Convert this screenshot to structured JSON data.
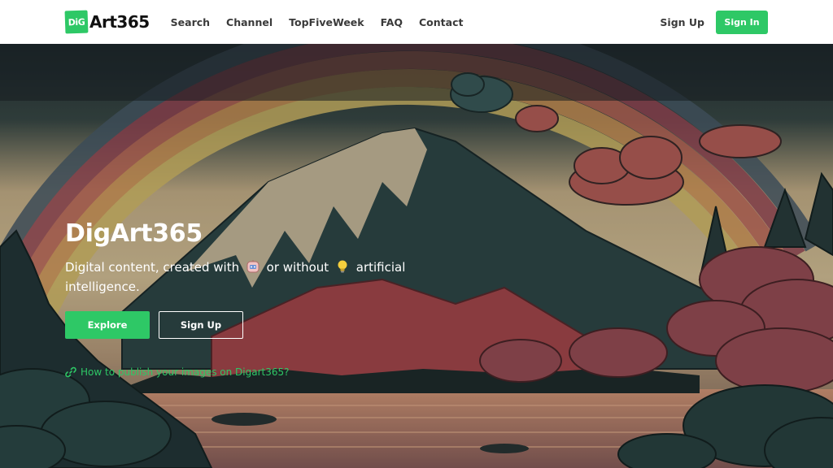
{
  "header": {
    "logo_badge": "DiG",
    "logo_text": "Art365",
    "nav": [
      {
        "label": "Search"
      },
      {
        "label": "Channel"
      },
      {
        "label": "TopFiveWeek"
      },
      {
        "label": "FAQ"
      },
      {
        "label": "Contact"
      }
    ],
    "signup_label": "Sign Up",
    "signin_label": "Sign In"
  },
  "hero": {
    "title": "DigArt365",
    "subtitle_part1": "Digital content, created with",
    "subtitle_part2": "or without",
    "subtitle_part3": "artificial intelligence.",
    "icon_robot": "robot-emoji-icon",
    "icon_bulb": "lightbulb-emoji-icon",
    "explore_label": "Explore",
    "signup_label": "Sign Up",
    "publish_link": "How to publish your images on Digart365?",
    "link_icon": "link-icon"
  },
  "colors": {
    "accent": "#2ec866",
    "header_bg": "#ffffff",
    "nav_text": "#3a3a3a"
  }
}
